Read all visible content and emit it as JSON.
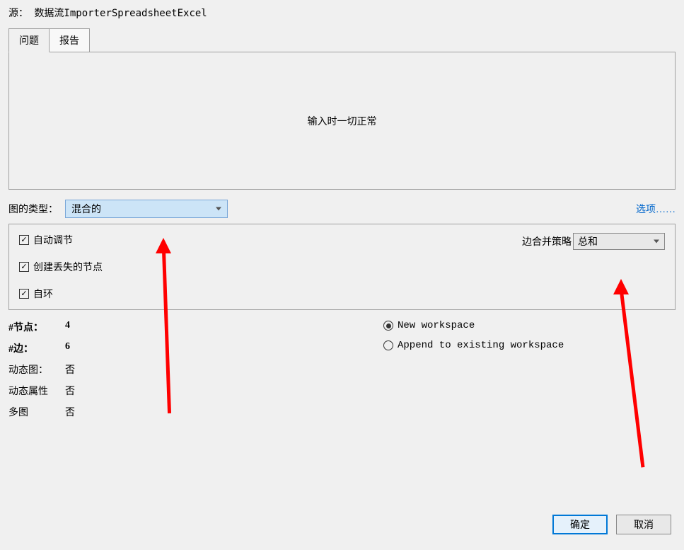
{
  "source": {
    "label": "源：",
    "value": "数据流ImporterSpreadsheetExcel"
  },
  "tabs": {
    "issues": "问题",
    "report": "报告"
  },
  "content": {
    "message": "输入时一切正常"
  },
  "graph_type": {
    "label": "图的类型：",
    "selected": "混合的"
  },
  "options_link": "选项……",
  "checkboxes": {
    "auto_adjust": "自动调节",
    "create_missing_nodes": "创建丢失的节点",
    "self_loop": "自环"
  },
  "merge_strategy": {
    "label": "边合并策略",
    "selected": "总和"
  },
  "stats": {
    "nodes_label": "#节点：",
    "nodes_value": "4",
    "edges_label": "#边：",
    "edges_value": "6",
    "dynamic_graph_label": "动态图：",
    "dynamic_graph_value": "否",
    "dynamic_attr_label": "动态属性",
    "dynamic_attr_value": "否",
    "multigraph_label": "多图",
    "multigraph_value": "否"
  },
  "workspace": {
    "new": "New workspace",
    "append": "Append to existing workspace"
  },
  "buttons": {
    "ok": "确定",
    "cancel": "取消"
  }
}
